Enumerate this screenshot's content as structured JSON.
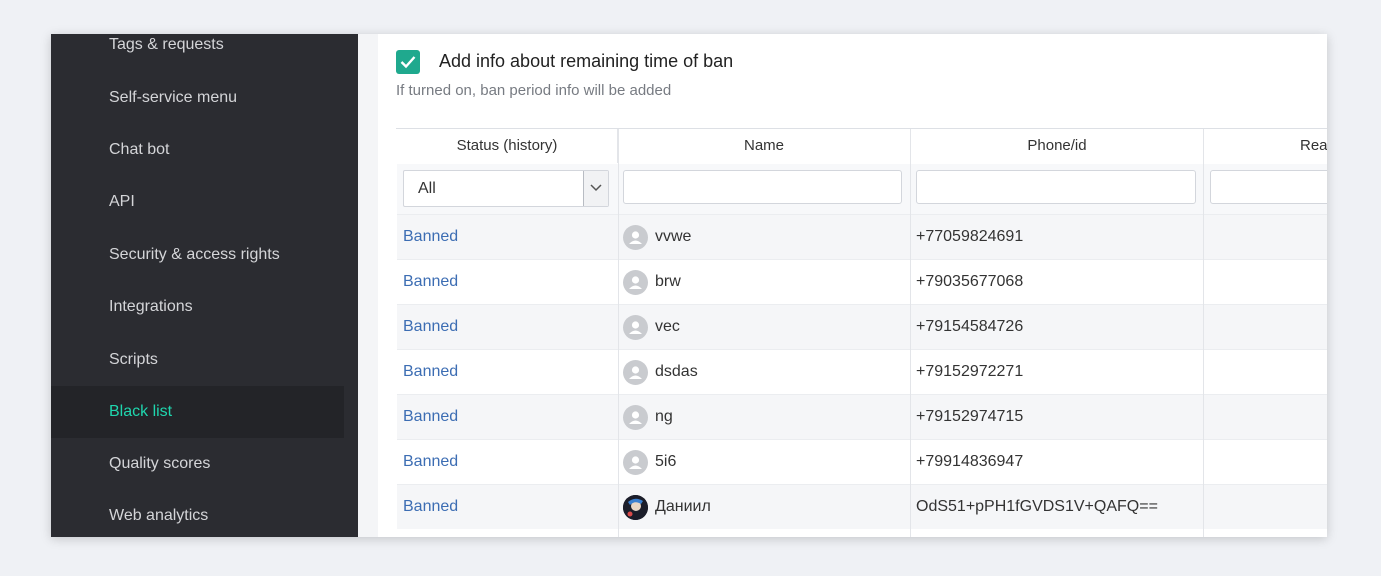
{
  "sidebar": {
    "items": [
      {
        "label": "Tags & requests"
      },
      {
        "label": "Self-service menu"
      },
      {
        "label": "Chat bot"
      },
      {
        "label": "API"
      },
      {
        "label": "Security & access rights"
      },
      {
        "label": "Integrations"
      },
      {
        "label": "Scripts"
      },
      {
        "label": "Black list",
        "active": true
      },
      {
        "label": "Quality scores"
      },
      {
        "label": "Web analytics"
      }
    ]
  },
  "setting": {
    "checked": true,
    "label": "Add info about remaining time of ban",
    "hint": "If turned on, ban period info will be added"
  },
  "table": {
    "columns": [
      "Status (history)",
      "Name",
      "Phone/id",
      "Reas"
    ],
    "status_filter": {
      "selected": "All"
    },
    "rows": [
      {
        "status": "Banned",
        "name": "vvwe",
        "phone": "+77059824691",
        "avatar": "default-user-icon"
      },
      {
        "status": "Banned",
        "name": "brw",
        "phone": "+79035677068",
        "avatar": "default-user-icon"
      },
      {
        "status": "Banned",
        "name": "vec",
        "phone": "+79154584726",
        "avatar": "default-user-icon"
      },
      {
        "status": "Banned",
        "name": "dsdas",
        "phone": "+79152972271",
        "avatar": "default-user-icon"
      },
      {
        "status": "Banned",
        "name": "ng",
        "phone": "+79152974715",
        "avatar": "default-user-icon"
      },
      {
        "status": "Banned",
        "name": "5i6",
        "phone": "+79914836947",
        "avatar": "default-user-icon"
      },
      {
        "status": "Banned",
        "name": "Даниил",
        "phone": "OdS51+pPH1fGVDS1V+QAFQ==",
        "avatar": "user-photo"
      }
    ]
  },
  "colors": {
    "sidebar_bg": "#2b2c31",
    "active_item": "#1fd6ae",
    "checkbox": "#1fa98e",
    "link": "#3c6db3"
  }
}
